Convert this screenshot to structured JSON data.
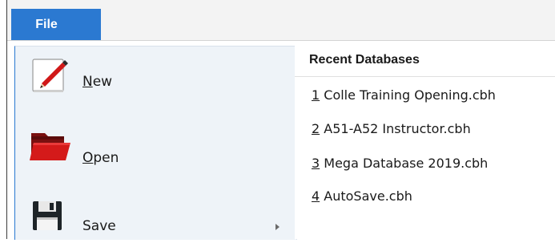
{
  "menubar": {
    "file_tab_label": "File"
  },
  "left_menu": {
    "new": {
      "accel": "N",
      "rest": "ew",
      "icon": "new-document-icon"
    },
    "open": {
      "accel": "O",
      "rest": "pen",
      "icon": "folder-open-icon"
    },
    "save": {
      "label": "Save",
      "icon": "save-disk-icon"
    }
  },
  "recent": {
    "header": "Recent Databases",
    "items": [
      {
        "num": "1",
        "name": " Colle Training Opening.cbh"
      },
      {
        "num": "2",
        "name": " A51-A52 Instructor.cbh"
      },
      {
        "num": "3",
        "name": " Mega Database 2019.cbh"
      },
      {
        "num": "4",
        "name": " AutoSave.cbh"
      }
    ]
  },
  "colors": {
    "accent": "#2b79d1",
    "pane_bg": "#eef3f8",
    "menubar_bg": "#f3f3f3"
  }
}
